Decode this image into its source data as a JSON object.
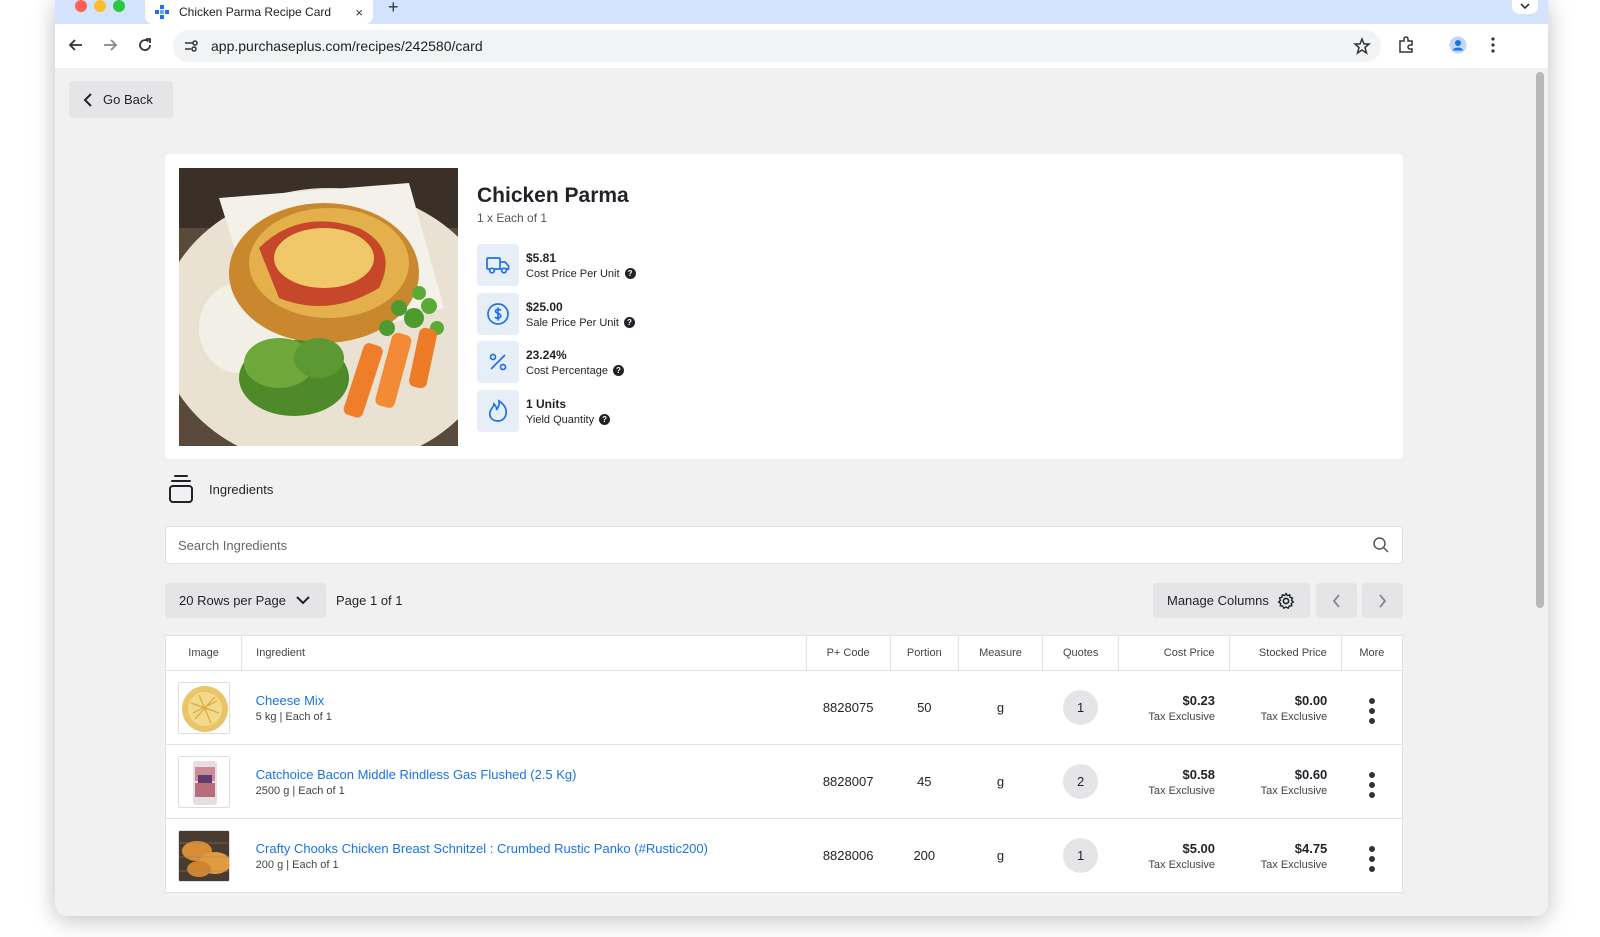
{
  "browser": {
    "tab_title": "Chicken Parma Recipe Card",
    "tab_close": "×",
    "new_tab": "+",
    "url": "app.purchaseplus.com/recipes/242580/card"
  },
  "page": {
    "go_back_label": "Go Back"
  },
  "recipe": {
    "title": "Chicken Parma",
    "subtitle": "1 x Each of 1",
    "stats": [
      {
        "icon": "truck-icon",
        "value": "$5.81",
        "label": "Cost Price Per Unit"
      },
      {
        "icon": "dollar-icon",
        "value": "$25.00",
        "label": "Sale Price Per Unit"
      },
      {
        "icon": "percent-icon",
        "value": "23.24%",
        "label": "Cost Percentage"
      },
      {
        "icon": "flame-icon",
        "value": "1 Units",
        "label": "Yield Quantity"
      }
    ],
    "help_glyph": "?"
  },
  "ingredients": {
    "heading": "Ingredients",
    "search_placeholder": "Search Ingredients",
    "rows_per_page": "20 Rows per Page",
    "page_info": "Page 1 of 1",
    "manage_columns": "Manage Columns",
    "columns": [
      "Image",
      "Ingredient",
      "P+ Code",
      "Portion",
      "Measure",
      "Quotes",
      "Cost Price",
      "Stocked Price",
      "More"
    ],
    "rows": [
      {
        "thumb": "cheese-image",
        "name": "Cheese Mix",
        "detail": "5 kg | Each of 1",
        "code": "8828075",
        "portion": "50",
        "measure": "g",
        "quotes": "1",
        "cost": "$0.23",
        "cost_tax": "Tax Exclusive",
        "stocked": "$0.00",
        "stocked_tax": "Tax Exclusive"
      },
      {
        "thumb": "bacon-image",
        "name": "Catchoice Bacon Middle Rindless Gas Flushed (2.5 Kg)",
        "detail": "2500 g | Each of 1",
        "code": "8828007",
        "portion": "45",
        "measure": "g",
        "quotes": "2",
        "cost": "$0.58",
        "cost_tax": "Tax Exclusive",
        "stocked": "$0.60",
        "stocked_tax": "Tax Exclusive"
      },
      {
        "thumb": "schnitzel-image",
        "name": "Crafty Chooks Chicken Breast Schnitzel : Crumbed Rustic Panko (#Rustic200)",
        "detail": "200 g | Each of 1",
        "code": "8828006",
        "portion": "200",
        "measure": "g",
        "quotes": "1",
        "cost": "$5.00",
        "cost_tax": "Tax Exclusive",
        "stocked": "$4.75",
        "stocked_tax": "Tax Exclusive"
      }
    ]
  },
  "colors": {
    "accent": "#1a73e8",
    "icon_bg": "#e8eef8",
    "page_bg": "#f1f1f2"
  }
}
